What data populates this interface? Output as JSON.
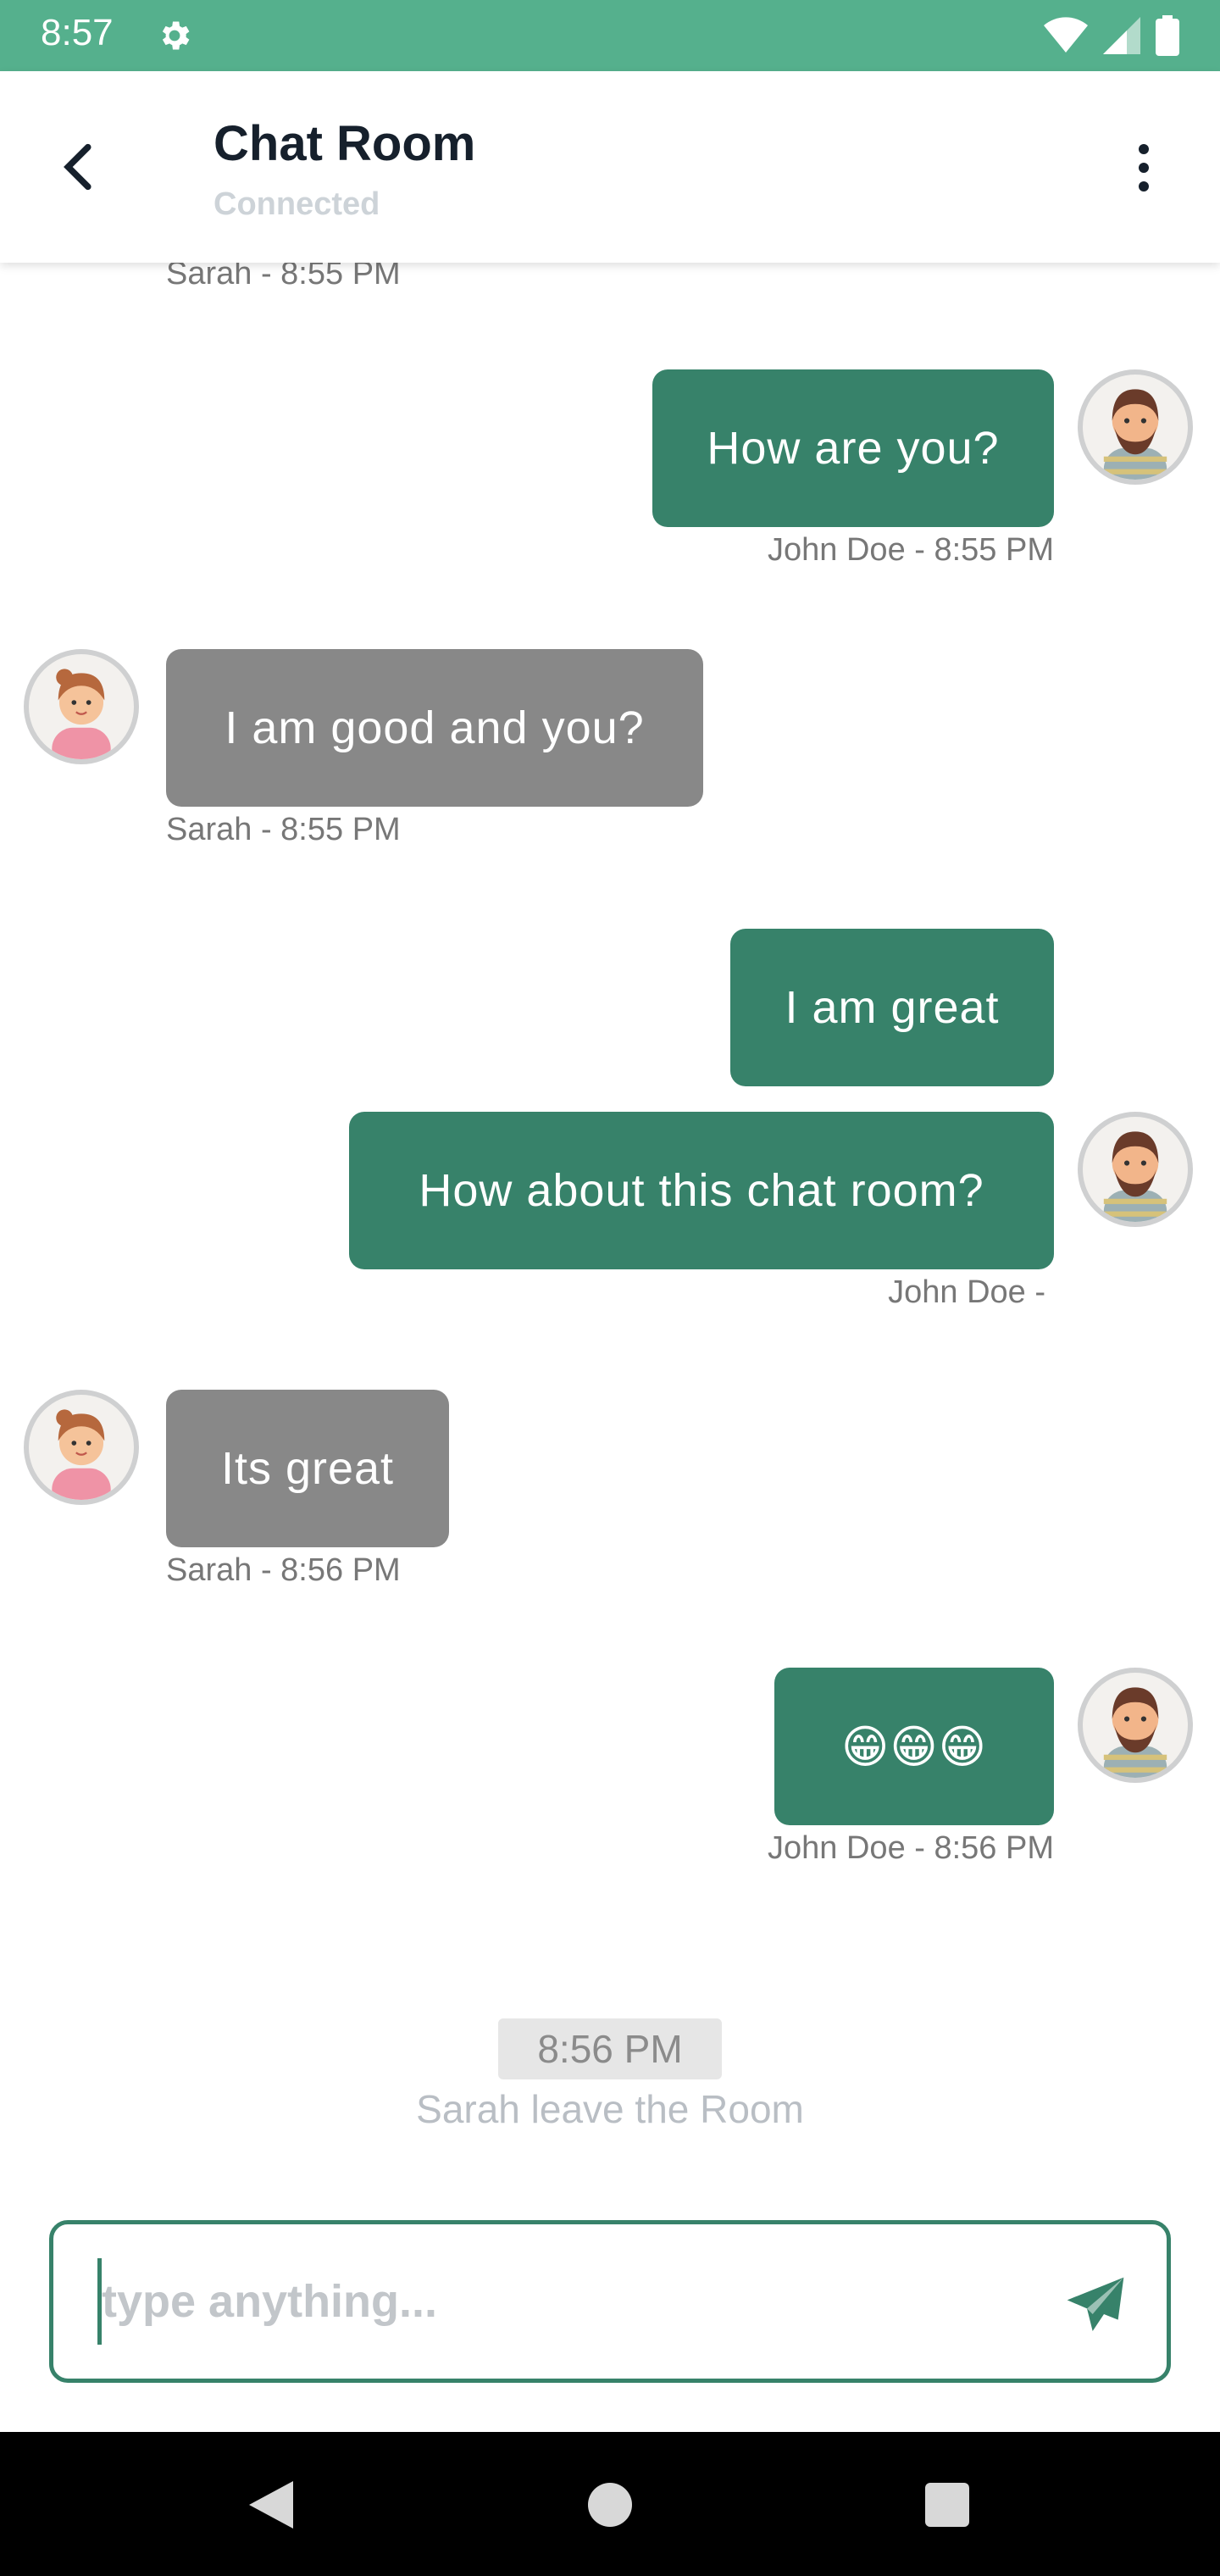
{
  "status_bar": {
    "time": "8:57",
    "icons": [
      "gear-icon",
      "wifi-icon",
      "signal-icon",
      "battery-icon"
    ]
  },
  "header": {
    "title": "Chat Room",
    "subtitle": "Connected",
    "back_icon": "back-arrow-icon",
    "menu_icon": "more-vert-icon"
  },
  "messages": [
    {
      "direction": "in",
      "text": "",
      "meta": "Sarah - 8:55 PM"
    },
    {
      "direction": "out",
      "text": "How are you?",
      "meta": "John Doe - 8:55 PM"
    },
    {
      "direction": "in",
      "text": "I am good and you?",
      "meta": "Sarah - 8:55 PM"
    },
    {
      "direction": "out",
      "text": "I am great",
      "meta": ""
    },
    {
      "direction": "out",
      "text": "How about this chat room?",
      "meta": "John Doe -"
    },
    {
      "direction": "in",
      "text": "Its great",
      "meta": "Sarah - 8:56 PM"
    },
    {
      "direction": "out",
      "text": "😁😁😁",
      "meta": "John Doe - 8:56 PM"
    }
  ],
  "system": {
    "time_badge": "8:56 PM",
    "notice": "Sarah leave the Room"
  },
  "composer": {
    "placeholder": "type anything...",
    "value": ""
  },
  "colors": {
    "status_bar": "#55b08d",
    "outgoing_bubble": "#37826a",
    "incoming_bubble": "#888888",
    "accent": "#37826a"
  }
}
